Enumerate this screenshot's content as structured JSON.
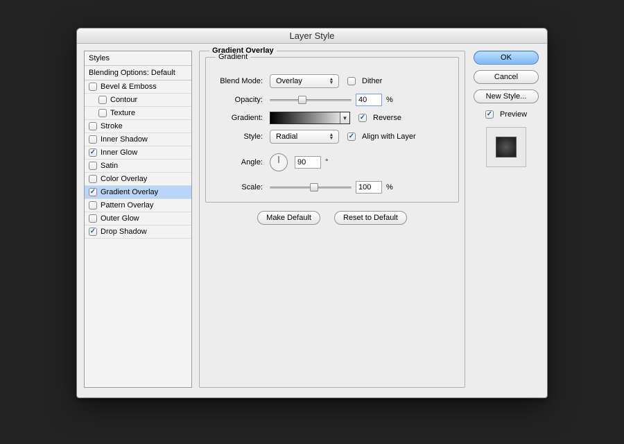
{
  "window": {
    "title": "Layer Style"
  },
  "sidebar": {
    "header_styles": "Styles",
    "header_blending": "Blending Options: Default",
    "items": [
      {
        "id": "bevel",
        "label": "Bevel & Emboss",
        "checked": false,
        "indent": 0
      },
      {
        "id": "contour",
        "label": "Contour",
        "checked": false,
        "indent": 1
      },
      {
        "id": "texture",
        "label": "Texture",
        "checked": false,
        "indent": 1
      },
      {
        "id": "stroke",
        "label": "Stroke",
        "checked": false,
        "indent": 0
      },
      {
        "id": "inner-shadow",
        "label": "Inner Shadow",
        "checked": false,
        "indent": 0
      },
      {
        "id": "inner-glow",
        "label": "Inner Glow",
        "checked": true,
        "indent": 0
      },
      {
        "id": "satin",
        "label": "Satin",
        "checked": false,
        "indent": 0
      },
      {
        "id": "color-overlay",
        "label": "Color Overlay",
        "checked": false,
        "indent": 0
      },
      {
        "id": "gradient-overlay",
        "label": "Gradient Overlay",
        "checked": true,
        "indent": 0,
        "selected": true
      },
      {
        "id": "pattern-overlay",
        "label": "Pattern Overlay",
        "checked": false,
        "indent": 0
      },
      {
        "id": "outer-glow",
        "label": "Outer Glow",
        "checked": false,
        "indent": 0
      },
      {
        "id": "drop-shadow",
        "label": "Drop Shadow",
        "checked": true,
        "indent": 0
      }
    ]
  },
  "settings": {
    "legend_outer": "Gradient Overlay",
    "legend_inner": "Gradient",
    "labels": {
      "blend_mode": "Blend Mode:",
      "opacity": "Opacity:",
      "gradient": "Gradient:",
      "style": "Style:",
      "angle": "Angle:",
      "scale": "Scale:"
    },
    "blend_mode": "Overlay",
    "dither": {
      "label": "Dither",
      "checked": false
    },
    "opacity": {
      "value": "40",
      "unit": "%",
      "slider_pct": 40
    },
    "reverse": {
      "label": "Reverse",
      "checked": true
    },
    "style": "Radial",
    "align": {
      "label": "Align with Layer",
      "checked": true
    },
    "angle": {
      "value": "90",
      "unit": "°"
    },
    "scale": {
      "value": "100",
      "unit": "%",
      "slider_pct": 54
    },
    "make_default": "Make Default",
    "reset_default": "Reset to Default"
  },
  "right": {
    "ok": "OK",
    "cancel": "Cancel",
    "new_style": "New Style...",
    "preview": {
      "label": "Preview",
      "checked": true
    }
  }
}
